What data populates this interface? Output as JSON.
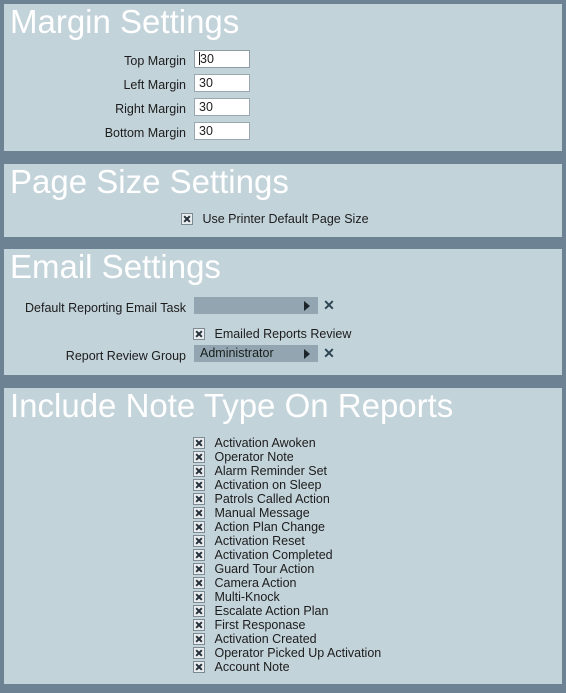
{
  "app": {
    "background_color": "#6d8293",
    "panel_color": "#c3d3da",
    "header_text_color": "#ffffff",
    "accent_color": "#2d4554"
  },
  "sections": {
    "margin": {
      "title": "Margin Settings",
      "fields": [
        {
          "label": "Top Margin",
          "value": "30",
          "focused": true
        },
        {
          "label": "Left Margin",
          "value": "30",
          "focused": false
        },
        {
          "label": "Right Margin",
          "value": "30",
          "focused": false
        },
        {
          "label": "Bottom Margin",
          "value": "30",
          "focused": false
        }
      ]
    },
    "page_size": {
      "title": "Page Size Settings",
      "checkbox": {
        "label": "Use Printer Default Page Size",
        "checked": true
      }
    },
    "email": {
      "title": "Email Settings",
      "default_task": {
        "label": "Default Reporting Email Task",
        "value": "",
        "clear_icon": "close-x-icon"
      },
      "emailed_reports_review": {
        "label": "Emailed Reports Review",
        "checked": true
      },
      "review_group": {
        "label": "Report Review Group",
        "value": "Administrator",
        "clear_icon": "close-x-icon"
      }
    },
    "note_types": {
      "title": "Include Note Type On Reports",
      "items": [
        {
          "label": "Activation Awoken",
          "checked": true
        },
        {
          "label": "Operator Note",
          "checked": true
        },
        {
          "label": "Alarm Reminder Set",
          "checked": true
        },
        {
          "label": "Activation on Sleep",
          "checked": true
        },
        {
          "label": "Patrols Called Action",
          "checked": true
        },
        {
          "label": "Manual Message",
          "checked": true
        },
        {
          "label": "Action Plan Change",
          "checked": true
        },
        {
          "label": "Activation Reset",
          "checked": true
        },
        {
          "label": "Activation Completed",
          "checked": true
        },
        {
          "label": "Guard Tour Action",
          "checked": true
        },
        {
          "label": "Camera Action",
          "checked": true
        },
        {
          "label": "Multi-Knock",
          "checked": true
        },
        {
          "label": "Escalate Action Plan",
          "checked": true
        },
        {
          "label": "First Responase",
          "checked": true
        },
        {
          "label": "Activation Created",
          "checked": true
        },
        {
          "label": "Operator Picked Up Activation",
          "checked": true
        },
        {
          "label": "Account Note",
          "checked": true
        }
      ]
    }
  }
}
